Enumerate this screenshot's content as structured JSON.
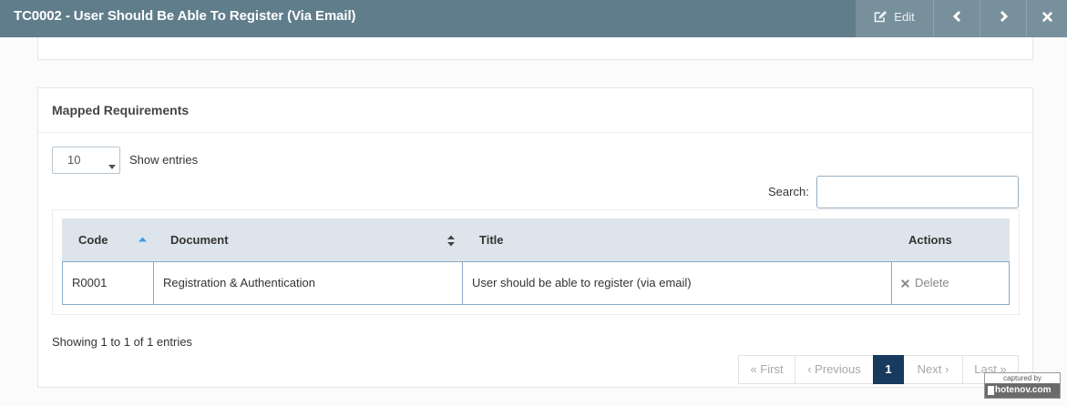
{
  "header": {
    "title": "TC0002 - User Should Be Able To Register (Via Email)",
    "edit_label": "Edit",
    "edit_icon": "edit-icon",
    "prev_icon": "chevron-left-icon",
    "next_icon": "chevron-right-icon",
    "close_icon": "close-icon"
  },
  "card": {
    "title": "Mapped Requirements"
  },
  "length_menu": {
    "selected": "10",
    "label": "Show entries",
    "caret_icon": "caret-down-icon"
  },
  "search": {
    "label": "Search:",
    "value": ""
  },
  "table": {
    "columns": [
      {
        "label": "Code",
        "sort_icon": "sort-asc-icon"
      },
      {
        "label": "Document",
        "sort_icon": "sort-both-icon"
      },
      {
        "label": "Title"
      },
      {
        "label": "Actions"
      }
    ],
    "rows": [
      {
        "code": "R0001",
        "document": "Registration & Authentication",
        "title": "User should be able to register (via email)",
        "action_icon": "times-icon",
        "action_label": "Delete"
      }
    ]
  },
  "info": "Showing 1 to 1 of 1 entries",
  "pagination": {
    "first": "« First",
    "previous": "‹ Previous",
    "current": "1",
    "next": "Next ›",
    "last": "Last »"
  },
  "watermark": {
    "line1": "captured by",
    "line2": "hotenov.com"
  },
  "colors": {
    "header_bg": "#607d8b",
    "header_btn_bg": "#78909c",
    "accent": "#3d9be9",
    "active_page": "#173a5e",
    "row_border": "#89a9c8",
    "thead_bg": "#dee4eb"
  }
}
